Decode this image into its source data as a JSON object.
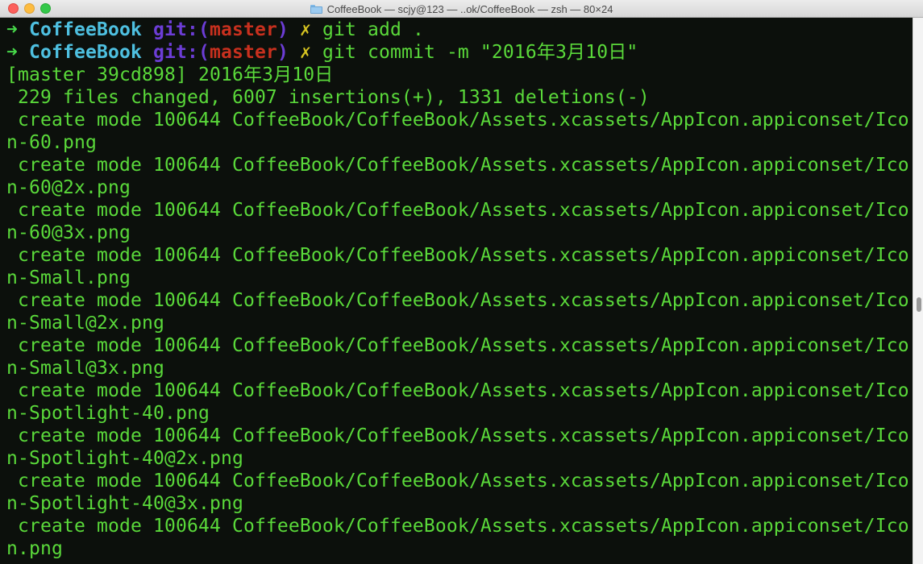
{
  "window": {
    "title": "CoffeeBook — scjy@123 — ..ok/CoffeeBook — zsh — 80×24"
  },
  "prompts": [
    {
      "arrow": "➜",
      "repo": "CoffeeBook",
      "git_label": "git:(",
      "branch": "master",
      "git_close": ")",
      "dirty_mark": "✗",
      "command": "git add ."
    },
    {
      "arrow": "➜",
      "repo": "CoffeeBook",
      "git_label": "git:(",
      "branch": "master",
      "git_close": ")",
      "dirty_mark": "✗",
      "command": "git commit -m \"2016年3月10日\""
    }
  ],
  "output": [
    "[master 39cd898] 2016年3月10日",
    " 229 files changed, 6007 insertions(+), 1331 deletions(-)",
    " create mode 100644 CoffeeBook/CoffeeBook/Assets.xcassets/AppIcon.appiconset/Ico",
    "n-60.png",
    " create mode 100644 CoffeeBook/CoffeeBook/Assets.xcassets/AppIcon.appiconset/Ico",
    "n-60@2x.png",
    " create mode 100644 CoffeeBook/CoffeeBook/Assets.xcassets/AppIcon.appiconset/Ico",
    "n-60@3x.png",
    " create mode 100644 CoffeeBook/CoffeeBook/Assets.xcassets/AppIcon.appiconset/Ico",
    "n-Small.png",
    " create mode 100644 CoffeeBook/CoffeeBook/Assets.xcassets/AppIcon.appiconset/Ico",
    "n-Small@2x.png",
    " create mode 100644 CoffeeBook/CoffeeBook/Assets.xcassets/AppIcon.appiconset/Ico",
    "n-Small@3x.png",
    " create mode 100644 CoffeeBook/CoffeeBook/Assets.xcassets/AppIcon.appiconset/Ico",
    "n-Spotlight-40.png",
    " create mode 100644 CoffeeBook/CoffeeBook/Assets.xcassets/AppIcon.appiconset/Ico",
    "n-Spotlight-40@2x.png",
    " create mode 100644 CoffeeBook/CoffeeBook/Assets.xcassets/AppIcon.appiconset/Ico",
    "n-Spotlight-40@3x.png",
    " create mode 100644 CoffeeBook/CoffeeBook/Assets.xcassets/AppIcon.appiconset/Ico",
    "n.png"
  ],
  "colors": {
    "background": "#0c100c",
    "output_text": "#5ad93a",
    "arrow": "#47d84a",
    "repo": "#4ec0e0",
    "git_label": "#6c3dd6",
    "branch": "#c8301e",
    "dirty_mark": "#d6c421"
  },
  "icons": {
    "title_icon": "folder-icon"
  }
}
